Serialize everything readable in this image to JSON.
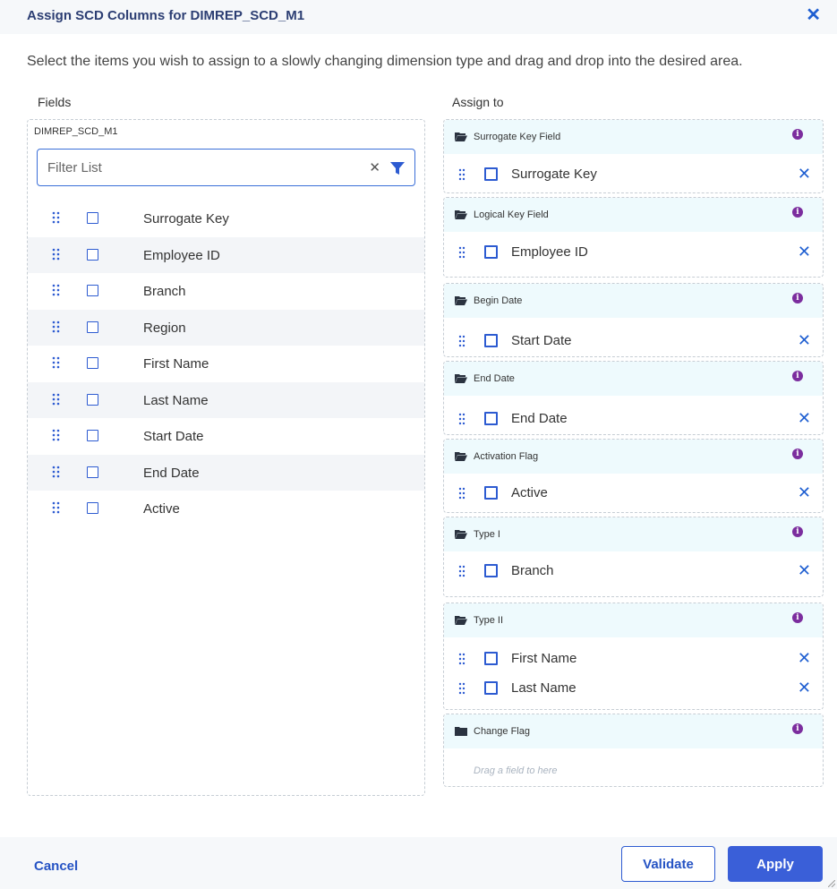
{
  "dialog": {
    "title": "Assign SCD Columns for DIMREP_SCD_M1",
    "close_icon": "close-icon",
    "instructions": "Select the items you wish to assign to a slowly changing dimension type and drag and drop into the desired area."
  },
  "fields": {
    "label": "Fields",
    "source": "DIMREP_SCD_M1",
    "filter_placeholder": "Filter List",
    "items": [
      {
        "label": "Surrogate Key"
      },
      {
        "label": "Employee ID"
      },
      {
        "label": "Branch"
      },
      {
        "label": "Region"
      },
      {
        "label": "First Name"
      },
      {
        "label": "Last Name"
      },
      {
        "label": "Start Date"
      },
      {
        "label": "End Date"
      },
      {
        "label": "Active"
      }
    ]
  },
  "assign": {
    "label": "Assign to",
    "groups": [
      {
        "title": "Surrogate Key Field",
        "items": [
          "Surrogate Key"
        ]
      },
      {
        "title": "Logical Key Field",
        "items": [
          "Employee ID"
        ]
      },
      {
        "title": "Begin Date",
        "items": [
          "Start Date"
        ]
      },
      {
        "title": "End Date",
        "items": [
          "End Date"
        ]
      },
      {
        "title": "Activation Flag",
        "items": [
          "Active"
        ]
      },
      {
        "title": "Type I",
        "items": [
          "Branch"
        ]
      },
      {
        "title": "Type II",
        "items": [
          "First Name",
          "Last Name"
        ]
      },
      {
        "title": "Change Flag",
        "items": [],
        "empty_hint": "Drag a field to here"
      }
    ]
  },
  "footer": {
    "cancel": "Cancel",
    "validate": "Validate",
    "apply": "Apply"
  },
  "colors": {
    "accent": "#2d5bd1",
    "info": "#7b2d9e",
    "group_header": "#eefafd"
  }
}
